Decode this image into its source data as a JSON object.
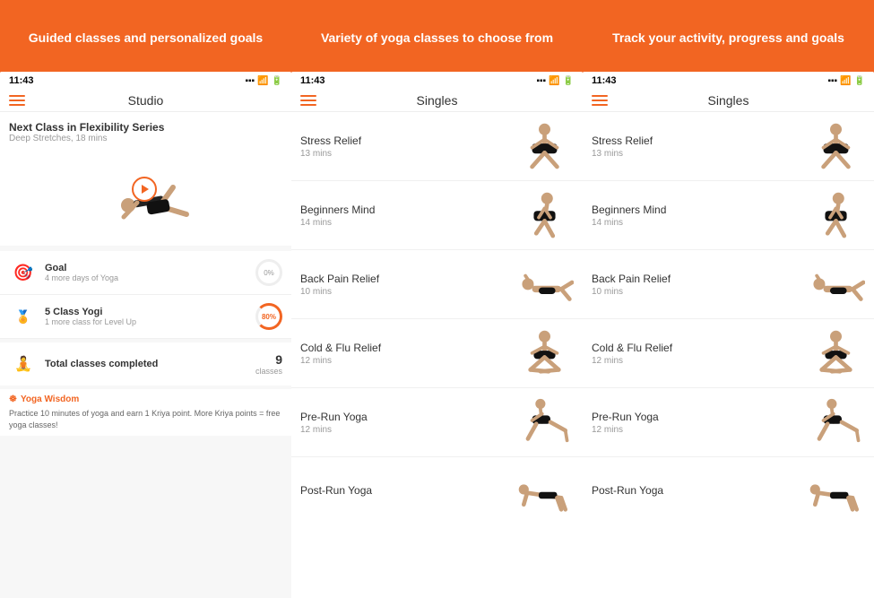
{
  "columns": [
    {
      "id": "col1",
      "header": "Guided classes and personalized goals",
      "nav_title": "Studio",
      "content_type": "studio",
      "next_class": {
        "title": "Next Class in Flexibility Series",
        "subtitle": "Deep Stretches, 18 mins"
      },
      "stats": [
        {
          "icon": "🎯",
          "label": "Goal",
          "sub": "4 more days of Yoga",
          "badge": "0%",
          "type": "circle-empty"
        },
        {
          "icon": "🏅",
          "label": "5 Class Yogi",
          "sub": "1 more class for Level Up",
          "badge": "80%",
          "type": "circle-orange"
        }
      ],
      "total_classes": {
        "label": "Total classes completed",
        "value": "9",
        "unit": "classes"
      },
      "wisdom": {
        "header": "Yoga Wisdom",
        "text": "Practice 10 minutes of yoga and earn 1 Kriya point. More Kriya points = free yoga classes!"
      }
    },
    {
      "id": "col2",
      "header": "Variety of yoga classes to choose from",
      "nav_title": "Singles",
      "content_type": "classes",
      "classes": [
        {
          "name": "Stress Relief",
          "duration": "13 mins",
          "pose": "seated_forward"
        },
        {
          "name": "Beginners Mind",
          "duration": "14 mins",
          "pose": "seated_prayer"
        },
        {
          "name": "Back Pain Relief",
          "duration": "10 mins",
          "pose": "lying_twist"
        },
        {
          "name": "Cold & Flu Relief",
          "duration": "12 mins",
          "pose": "seated_cross"
        },
        {
          "name": "Pre-Run Yoga",
          "duration": "12 mins",
          "pose": "lunge"
        },
        {
          "name": "Post-Run Yoga",
          "duration": "",
          "pose": "plank"
        }
      ]
    },
    {
      "id": "col3",
      "header": "Track your activity, progress and goals",
      "nav_title": "Singles",
      "content_type": "classes",
      "classes": [
        {
          "name": "Stress Relief",
          "duration": "13 mins",
          "pose": "seated_forward"
        },
        {
          "name": "Beginners Mind",
          "duration": "14 mins",
          "pose": "seated_prayer"
        },
        {
          "name": "Back Pain Relief",
          "duration": "10 mins",
          "pose": "lying_twist"
        },
        {
          "name": "Cold & Flu Relief",
          "duration": "12 mins",
          "pose": "seated_cross"
        },
        {
          "name": "Pre-Run Yoga",
          "duration": "12 mins",
          "pose": "lunge"
        },
        {
          "name": "Post-Run Yoga",
          "duration": "",
          "pose": "plank"
        }
      ]
    }
  ],
  "status_bar": {
    "time": "11:43"
  }
}
